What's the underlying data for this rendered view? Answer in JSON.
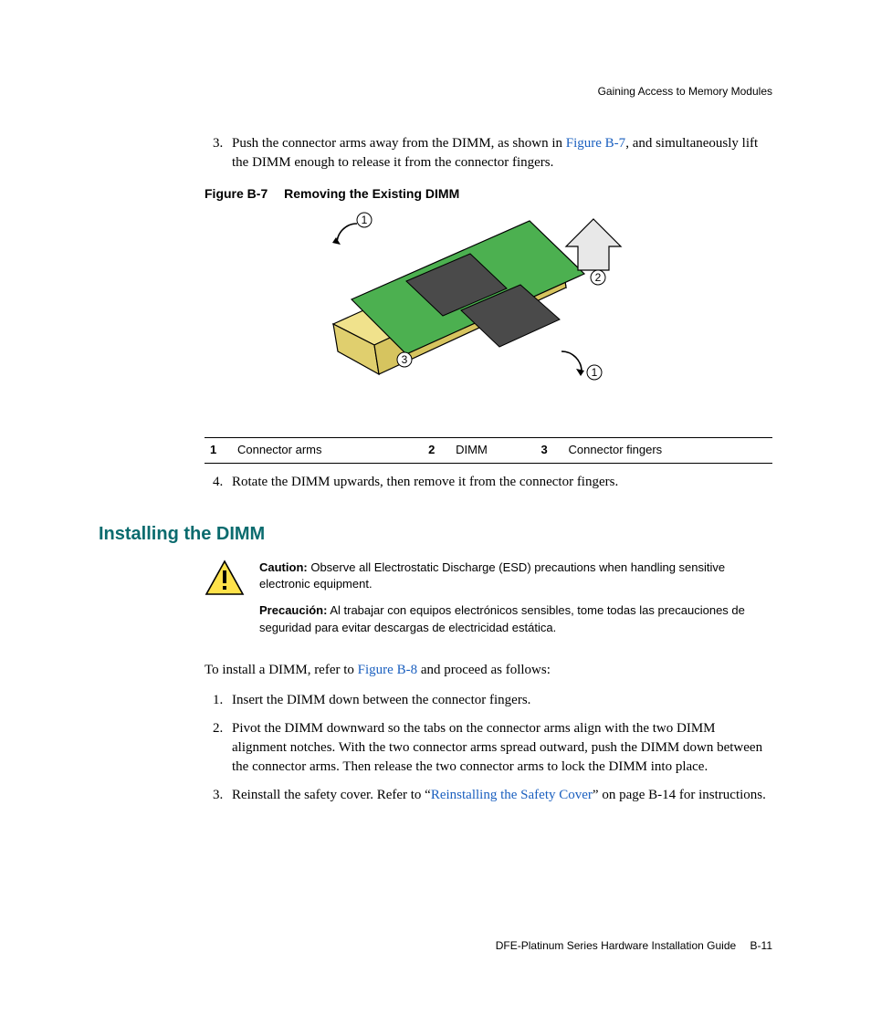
{
  "header": {
    "running_head": "Gaining Access to Memory Modules"
  },
  "steps_remove": {
    "s3_num": "3.",
    "s3_a": "Push the connector arms away from the DIMM, as shown in ",
    "s3_ref": "Figure B-7",
    "s3_b": ", and simultaneously lift the DIMM enough to release it from the connector fingers.",
    "s4_num": "4.",
    "s4": "Rotate the DIMM upwards, then remove it from the connector fingers."
  },
  "figure": {
    "label": "Figure B-7",
    "title": "Removing the Existing DIMM",
    "callout_1": "1",
    "callout_2": "2",
    "callout_3": "3"
  },
  "legend": {
    "n1": "1",
    "t1": "Connector arms",
    "n2": "2",
    "t2": "DIMM",
    "n3": "3",
    "t3": "Connector fingers"
  },
  "section": {
    "heading": "Installing the DIMM"
  },
  "caution": {
    "label_en": "Caution:",
    "text_en": "Observe all Electrostatic Discharge (ESD) precautions when handling sensitive electronic equipment.",
    "label_es": "Precaución:",
    "text_es": "Al trabajar con equipos electrónicos sensibles, tome todas las precauciones de seguridad para evitar descargas  de electricidad estática."
  },
  "install_intro": {
    "a": "To install a DIMM, refer to ",
    "ref": "Figure B-8",
    "b": " and proceed as follows:"
  },
  "steps_install": {
    "s1": "Insert the DIMM down between the connector fingers.",
    "s2": "Pivot the DIMM downward so the tabs on the connector arms align with the two DIMM alignment notches. With the two connector arms spread outward, push the DIMM down between the connector arms. Then release the two connector arms to lock the DIMM into place.",
    "s3_a": "Reinstall the safety cover. Refer to “",
    "s3_ref": "Reinstalling the Safety Cover",
    "s3_b": "” on page B-14 for instructions."
  },
  "footer": {
    "doc": "DFE-Platinum Series Hardware Installation Guide",
    "page": "B-11"
  }
}
